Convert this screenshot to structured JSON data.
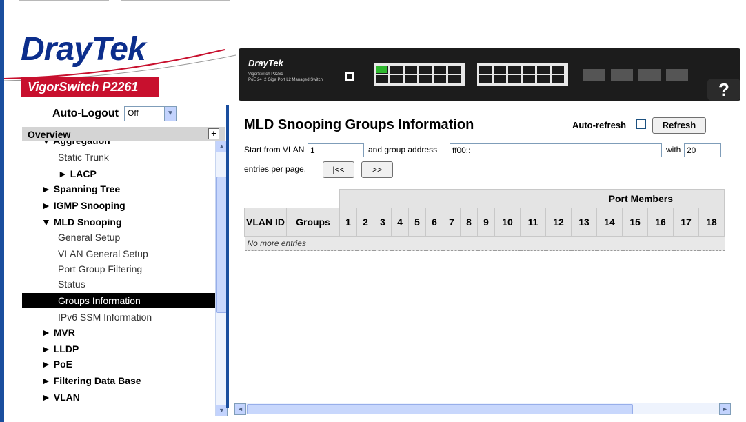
{
  "banner": {
    "logo_dray": "Dray",
    "logo_tek": "Tek",
    "model": "VigorSwitch P2261",
    "device_brand": "DrayTek",
    "device_model": "VigorSwitch P2261",
    "device_sub": "PoE 24+2 Giga Port L2 Managed Switch",
    "help": "?"
  },
  "sidebar": {
    "autologout_label": "Auto-Logout",
    "autologout_value": "Off",
    "overview": "Overview",
    "items": [
      {
        "label": "▼ Aggregation",
        "bold": true
      },
      {
        "label": "Static Trunk"
      },
      {
        "label": "► LACP",
        "bold": true
      },
      {
        "label": "► Spanning Tree",
        "bold": true
      },
      {
        "label": "► IGMP Snooping",
        "bold": true
      },
      {
        "label": "▼ MLD Snooping",
        "bold": true
      },
      {
        "label": "General Setup"
      },
      {
        "label": "VLAN General Setup"
      },
      {
        "label": "Port Group Filtering"
      },
      {
        "label": "Status"
      },
      {
        "label": "Groups Information",
        "active": true
      },
      {
        "label": "IPv6 SSM Information"
      },
      {
        "label": "► MVR",
        "bold": true
      },
      {
        "label": "► LLDP",
        "bold": true
      },
      {
        "label": "► PoE",
        "bold": true
      },
      {
        "label": "► Filtering Data Base",
        "bold": true
      },
      {
        "label": "► VLAN",
        "bold": true
      }
    ]
  },
  "main": {
    "title": "MLD Snooping Groups Information",
    "auto_refresh_label": "Auto-refresh",
    "refresh_button": "Refresh",
    "start_vlan_label": "Start from VLAN",
    "start_vlan_value": "1",
    "group_address_label": "and group address",
    "group_address_value": "ff00::",
    "with_label": "with",
    "with_value": "20",
    "entries_label": "entries per page.",
    "first_button": "|<<",
    "next_button": ">>",
    "table": {
      "port_members_header": "Port Members",
      "vlan_id_header": "VLAN ID",
      "groups_header": "Groups",
      "ports": [
        "1",
        "2",
        "3",
        "4",
        "5",
        "6",
        "7",
        "8",
        "9",
        "10",
        "11",
        "12",
        "13",
        "14",
        "15",
        "16",
        "17",
        "18"
      ],
      "empty_message": "No more entries"
    }
  }
}
